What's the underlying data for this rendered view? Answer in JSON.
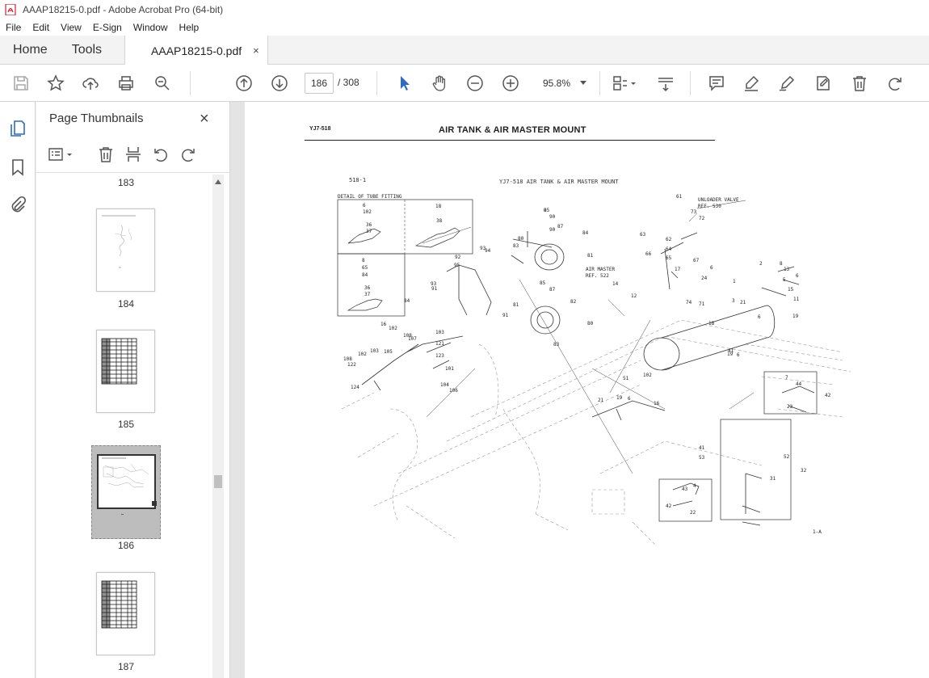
{
  "window": {
    "title": "AAAP18215-0.pdf - Adobe Acrobat Pro (64-bit)"
  },
  "menu": {
    "items": [
      "File",
      "Edit",
      "View",
      "E-Sign",
      "Window",
      "Help"
    ]
  },
  "tabs": {
    "home": "Home",
    "tools": "Tools",
    "document": "AAAP18215-0.pdf",
    "close_glyph": "×"
  },
  "toolbar": {
    "current_page": "186",
    "total_pages": "/ 308",
    "zoom": "95.8%",
    "icons": [
      "save-icon",
      "bookmark-star-icon",
      "upload-icon",
      "print-icon",
      "search-zoom-icon",
      "page-up-icon",
      "page-down-icon",
      "select-cursor-icon",
      "hand-icon",
      "zoom-out-icon",
      "zoom-in-icon",
      "page-fit-icon",
      "scroll-mode-icon",
      "comment-icon",
      "highlight-icon",
      "sign-icon",
      "edit-text-icon",
      "delete-icon",
      "undo-icon"
    ]
  },
  "panel": {
    "title": "Page Thumbnails",
    "close_glyph": "×",
    "thumbnails": [
      {
        "label": "183"
      },
      {
        "label": "184"
      },
      {
        "label": "185"
      },
      {
        "label": "186"
      },
      {
        "label": "187"
      }
    ]
  },
  "document": {
    "code": "YJ7-518",
    "title": "AIR TANK & AIR MASTER MOUNT",
    "drawing": {
      "ref_code": "518-1",
      "heading": "YJ7-518   AIR TANK & AIR MASTER MOUNT",
      "detail_label": "DETAIL OF TUBE FITTING",
      "unloader_label": "UNLOADER VALVE",
      "unloader_ref": "REF. 530",
      "air_master_label": "AIR MASTER",
      "air_master_ref": "REF. 522",
      "footer_code": "1-A",
      "detail_a": [
        "6",
        "102",
        "36",
        "37"
      ],
      "detail_b": [
        "18",
        "38"
      ],
      "detail_c": [
        "8",
        "65",
        "84",
        "36",
        "37"
      ],
      "callouts": [
        "85",
        "90",
        "87",
        "90",
        "84",
        "81",
        "93",
        "94",
        "92",
        "95",
        "83",
        "80",
        "93",
        "91",
        "85",
        "87",
        "84",
        "81",
        "91",
        "82",
        "80",
        "83",
        "61",
        "73",
        "72",
        "63",
        "62",
        "64",
        "66",
        "65",
        "67",
        "17",
        "6",
        "24",
        "2",
        "8",
        "13",
        "6",
        "5",
        "14",
        "12",
        "71",
        "74",
        "1",
        "15",
        "3",
        "11",
        "6",
        "21",
        "19",
        "16",
        "102",
        "108",
        "107",
        "103",
        "121",
        "123",
        "101",
        "103",
        "102",
        "105",
        "108",
        "122",
        "124",
        "104",
        "106",
        "102",
        "51",
        "6",
        "19",
        "21",
        "16",
        "7",
        "44",
        "42",
        "23",
        "41",
        "53",
        "52",
        "31",
        "32",
        "4",
        "43",
        "42",
        "22",
        "41",
        "19",
        "18",
        "6",
        "9"
      ]
    }
  }
}
